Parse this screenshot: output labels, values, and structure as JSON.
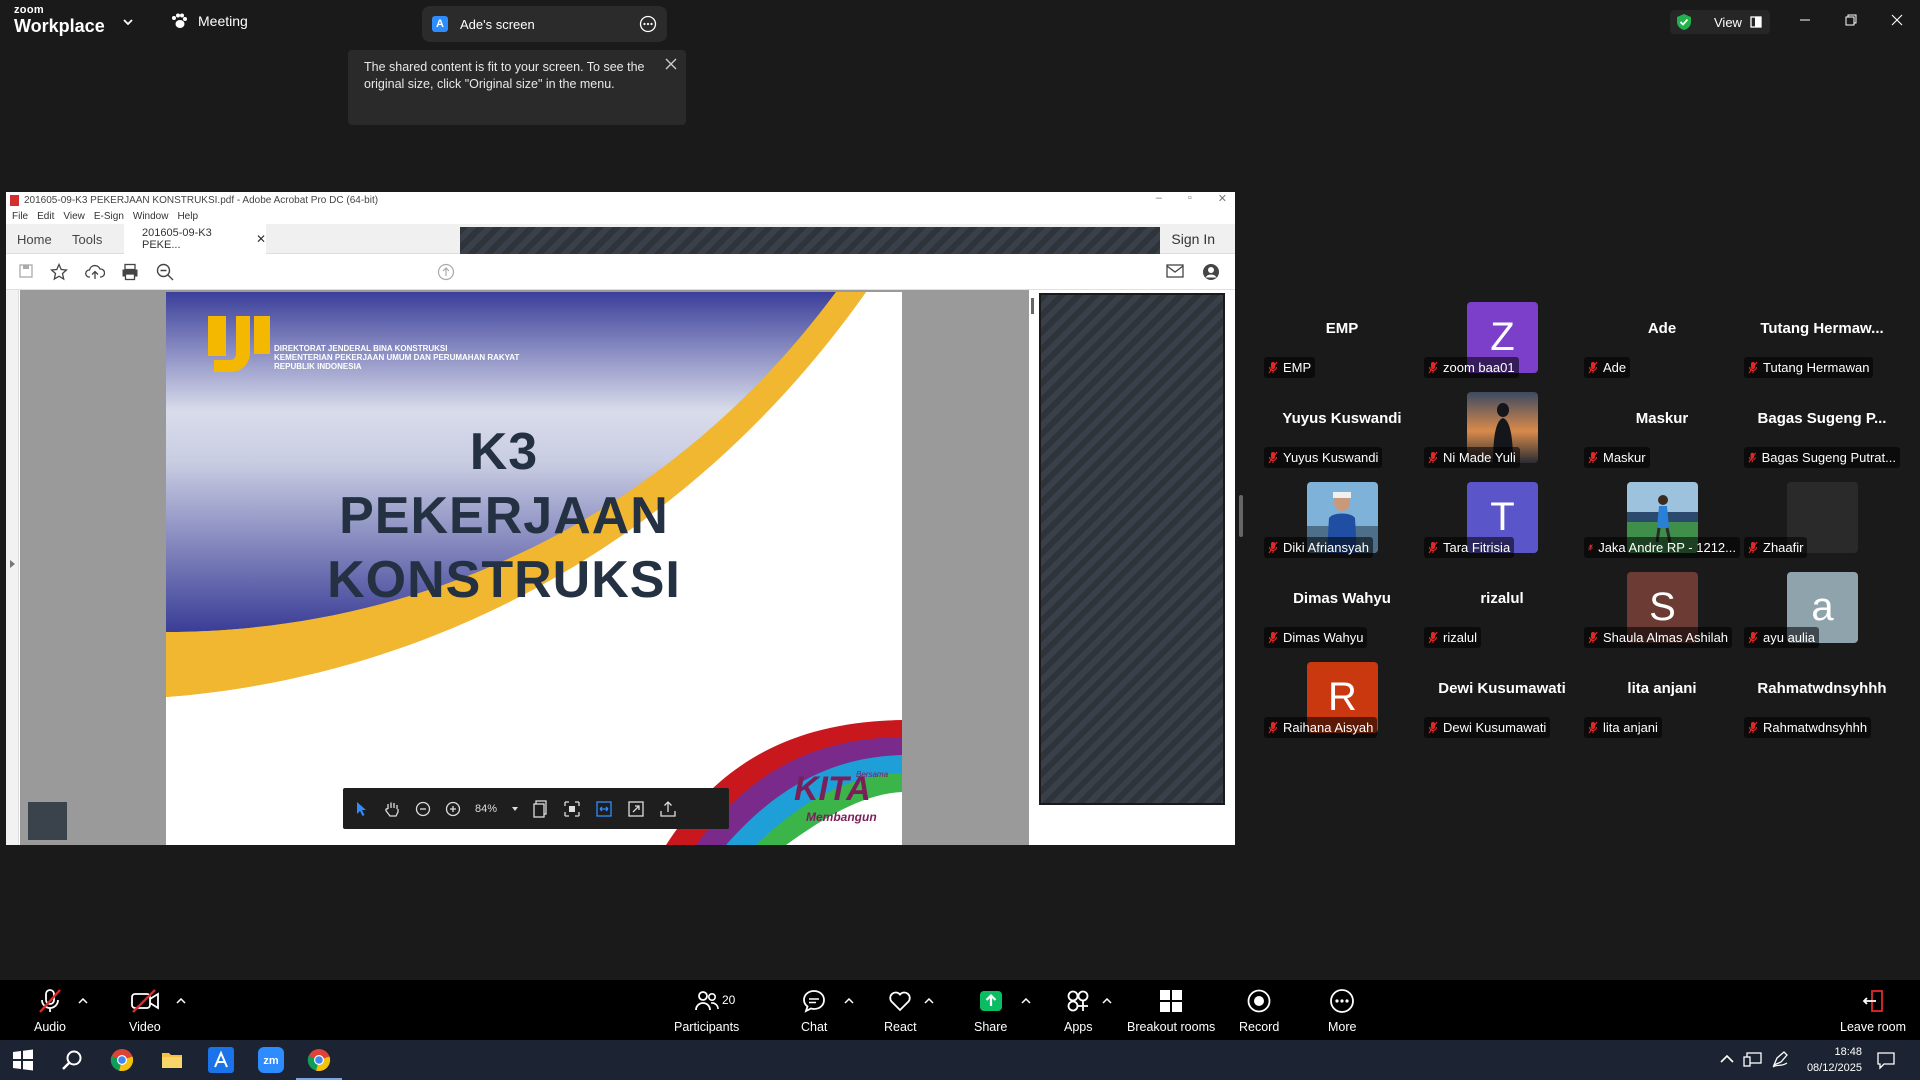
{
  "zoom": {
    "logo_top": "zoom",
    "logo_bottom": "Workplace",
    "meeting_label": "Meeting",
    "screen_tab": {
      "badge": "A",
      "label": "Ade's screen"
    },
    "view_label": "View",
    "tooltip": "The shared content is fit to your screen. To see the original size, click \"Original size\" in the menu."
  },
  "acrobat": {
    "title": "201605-09-K3 PEKERJAAN KONSTRUKSI.pdf - Adobe Acrobat Pro DC (64-bit)",
    "menu": [
      "File",
      "Edit",
      "View",
      "E-Sign",
      "Window",
      "Help"
    ],
    "tabs": {
      "home": "Home",
      "tools": "Tools",
      "doc": "201605-09-K3 PEKE...",
      "sign_in": "Sign In"
    },
    "zoom_level": "84%",
    "slide": {
      "org_lines": [
        "DIREKTORAT JENDERAL BINA KONSTRUKSI",
        "KEMENTERIAN PEKERJAAN UMUM DAN PERUMAHAN RAKYAT",
        "REPUBLIK INDONESIA"
      ],
      "title_line1": "K3 PEKERJAAN",
      "title_line2": "KONSTRUKSI",
      "kita_top": "Bersama",
      "kita": "KITA",
      "kita_sub": "Membangun"
    }
  },
  "participants": [
    {
      "big": "EMP",
      "label": "EMP"
    },
    {
      "avatar": "Z",
      "color": "#7b3fc9",
      "label": "zoom baa01"
    },
    {
      "big": "Ade",
      "label": "Ade"
    },
    {
      "big": "Tutang Hermaw...",
      "label": "Tutang Hermawan"
    },
    {
      "big": "Yuyus Kuswandi",
      "label": "Yuyus Kuswandi"
    },
    {
      "photo": "sunset",
      "label": "Ni Made Yuli"
    },
    {
      "big": "Maskur",
      "label": "Maskur"
    },
    {
      "big": "Bagas Sugeng P...",
      "label": "Bagas Sugeng Putrat..."
    },
    {
      "photo": "person-blue",
      "label": "Diki Afriansyah"
    },
    {
      "avatar": "T",
      "color": "#5a55c8",
      "label": "Tara Fitrisia"
    },
    {
      "photo": "field",
      "label": "Jaka Andre RP - 1212..."
    },
    {
      "avatar": "",
      "color": "#2a2a2a",
      "label": "Zhaafir"
    },
    {
      "big": "Dimas Wahyu",
      "label": "Dimas Wahyu"
    },
    {
      "big": "rizalul",
      "label": "rizalul"
    },
    {
      "avatar": "S",
      "color": "#6b3b34",
      "label": "Shaula Almas Ashilah"
    },
    {
      "avatar": "a",
      "color": "#8fa3ad",
      "label": "ayu aulia"
    },
    {
      "avatar": "R",
      "color": "#c9380e",
      "label": "Raihana Aisyah"
    },
    {
      "big": "Dewi Kusumawati",
      "label": "Dewi Kusumawati"
    },
    {
      "big": "lita anjani",
      "label": "lita anjani"
    },
    {
      "big": "Rahmatwdnsyhhh",
      "label": "Rahmatwdnsyhhh"
    }
  ],
  "toolbar": {
    "audio": "Audio",
    "video": "Video",
    "participants": "Participants",
    "participants_count": "20",
    "chat": "Chat",
    "react": "React",
    "share": "Share",
    "apps": "Apps",
    "breakout": "Breakout rooms",
    "record": "Record",
    "more": "More",
    "leave": "Leave room"
  },
  "taskbar": {
    "time": "18:48",
    "date": "08/12/2025"
  },
  "colors": {
    "share_green": "#0bbd62",
    "mic_red": "#e02828",
    "zoom_blue": "#2d8cff"
  }
}
